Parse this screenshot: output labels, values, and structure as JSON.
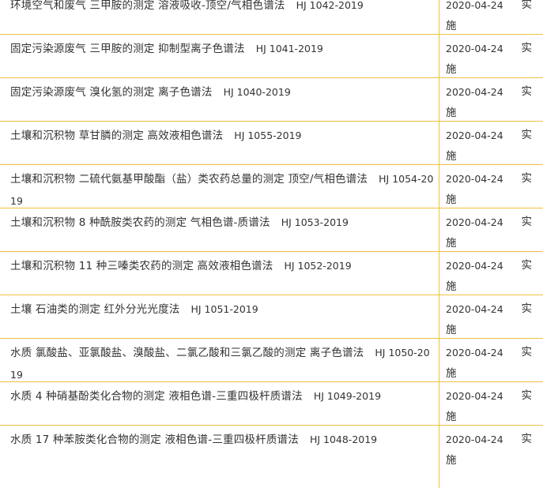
{
  "rows": [
    {
      "name": "环境空气和废气 三甲胺的测定 溶液吸收-顶空/气相色谱法",
      "code": "HJ 1042-2019",
      "date": "2020-04-24",
      "status_first": "实",
      "status_second": "施"
    },
    {
      "name": "固定污染源废气 三甲胺的测定 抑制型离子色谱法",
      "code": "HJ 1041-2019",
      "date": "2020-04-24",
      "status_first": "实",
      "status_second": "施"
    },
    {
      "name": "固定污染源废气 溴化氢的测定 离子色谱法",
      "code": "HJ 1040-2019",
      "date": "2020-04-24",
      "status_first": "实",
      "status_second": "施"
    },
    {
      "name": "土壤和沉积物 草甘膦的测定 高效液相色谱法",
      "code": "HJ 1055-2019",
      "date": "2020-04-24",
      "status_first": "实",
      "status_second": "施"
    },
    {
      "name": "土壤和沉积物 二硫代氨基甲酸酯（盐）类农药总量的测定 顶空/气相色谱法",
      "code": "HJ 1054-2019",
      "date": "2020-04-24",
      "status_first": "实",
      "status_second": "施"
    },
    {
      "name": "土壤和沉积物 8 种酰胺类农药的测定 气相色谱-质谱法",
      "code": "HJ 1053-2019",
      "date": "2020-04-24",
      "status_first": "实",
      "status_second": "施"
    },
    {
      "name": "土壤和沉积物 11 种三嗪类农药的测定 高效液相色谱法",
      "code": "HJ 1052-2019",
      "date": "2020-04-24",
      "status_first": "实",
      "status_second": "施"
    },
    {
      "name": "土壤 石油类的测定 红外分光光度法",
      "code": "HJ 1051-2019",
      "date": "2020-04-24",
      "status_first": "实",
      "status_second": "施"
    },
    {
      "name": "水质 氯酸盐、亚氯酸盐、溴酸盐、二氯乙酸和三氯乙酸的测定 离子色谱法",
      "code": "HJ 1050-2019",
      "date": "2020-04-24",
      "status_first": "实",
      "status_second": "施"
    },
    {
      "name": "水质 4 种硝基酚类化合物的测定 液相色谱-三重四极杆质谱法",
      "code": "HJ 1049-2019",
      "date": "2020-04-24",
      "status_first": "实",
      "status_second": "施"
    },
    {
      "name": "水质 17 种苯胺类化合物的测定 液相色谱-三重四极杆质谱法",
      "code": "HJ 1048-2019",
      "date": "2020-04-24",
      "status_first": "实",
      "status_second": "施"
    }
  ],
  "colors": {
    "border": "#f0c040",
    "text": "#333333",
    "background": "#ffffff"
  }
}
